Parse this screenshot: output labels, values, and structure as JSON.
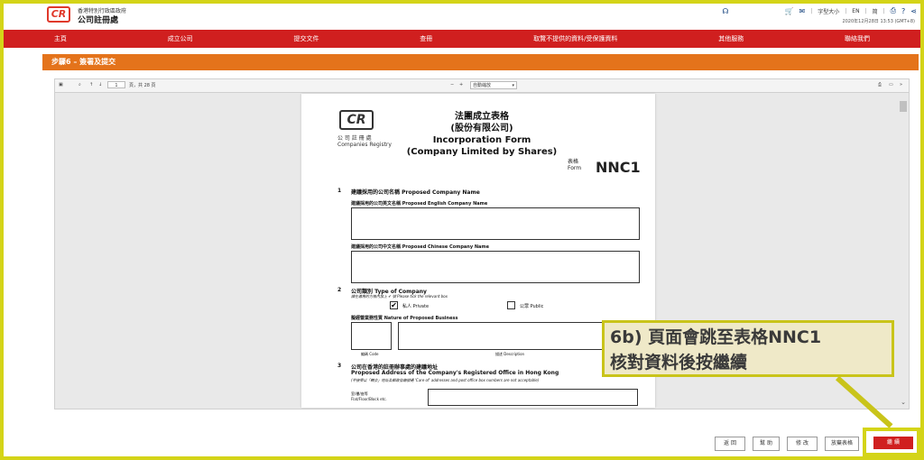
{
  "header": {
    "logo_mark": "CR",
    "org_line1": "香港特別行政區政府",
    "org_line2": "公司註冊處",
    "font_size_label": "字型大小",
    "lang_en": "EN",
    "lang_sc": "简",
    "timestamp": "2020年12月28日 13:53 (GMT+8)"
  },
  "nav": {
    "items": [
      "主頁",
      "成立公司",
      "提交文件",
      "查冊",
      "取覽不提供的資料/受保護資料",
      "其他服務",
      "聯絡我們"
    ]
  },
  "step": {
    "title": "步驟6 – 簽署及提交"
  },
  "viewer": {
    "page_current": "1",
    "page_total": "頁，共 28 頁",
    "zoom_value": "自動縮放"
  },
  "form": {
    "logo_mark": "CR",
    "registry_zh": "公 司 註 冊 處",
    "registry_en": "Companies Registry",
    "title_zh": "法團成立表格",
    "title_zh_sub": "(股份有限公司)",
    "title_en": "Incorporation Form",
    "title_en_sub": "(Company Limited by Shares)",
    "form_label_zh": "表格",
    "form_label_en": "Form",
    "form_no": "NNC1",
    "s1_num": "1",
    "s1_title": "建議採用的公司名稱 Proposed Company Name",
    "s1_en_label": "建議採用的公司英文名稱 Proposed English Company Name",
    "s1_zh_label": "建議採用的公司中文名稱 Proposed Chinese Company Name",
    "s2_num": "2",
    "s2_title": "公司類別 Type of Company",
    "s2_hint": "請在適用的方格內加上 ✔ 號 Please tick the relevant box",
    "s2_private": "私人 Private",
    "s2_public": "公眾 Public",
    "s2_business": "擬經營業務性質 Nature of Proposed Business",
    "s2_code": "編碼 Code",
    "s2_desc": "描述 Description",
    "s3_num": "3",
    "s3_title_zh": "公司在香港的註冊辦事處的建議地址",
    "s3_title_en": "Proposed Address of the Company's Registered Office in Hong Kong",
    "s3_hint": "(不接受以「轉交」地址及郵政信箱號碼 'Care of' addresses and post office box numbers are not acceptable)",
    "s3_flat": "室/樓/座等",
    "s3_flat_en": "Flat/Floor/Block etc."
  },
  "callout": {
    "line1": "6b) 頁面會跳至表格NNC1",
    "line2": "核對資料後按繼續"
  },
  "buttons": {
    "back": "返 回",
    "help": "幫 助",
    "edit": "修 改",
    "abandon": "放棄表格",
    "continue": "繼 續"
  },
  "colors": {
    "nav_red": "#d01f1f",
    "step_orange": "#e4731b",
    "highlight_yellow": "#d4d418"
  }
}
